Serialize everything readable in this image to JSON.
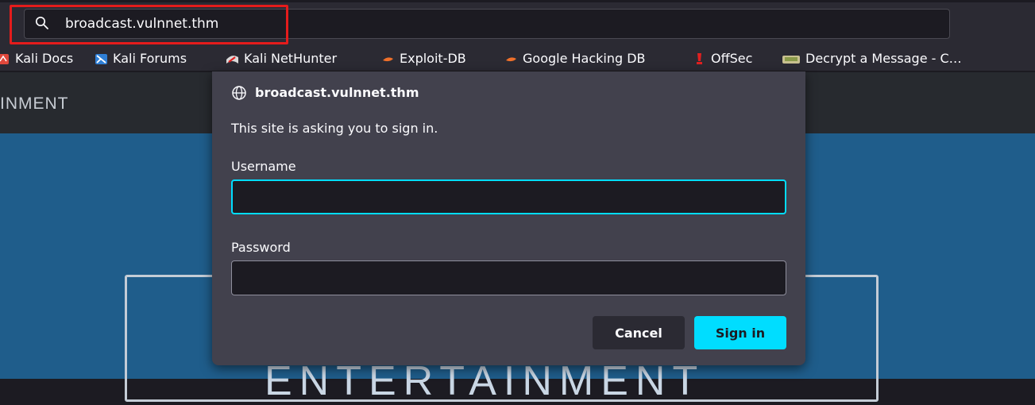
{
  "url_bar": {
    "text": "broadcast.vulnnet.thm"
  },
  "bookmarks": [
    {
      "label": "Kali Docs",
      "icon": "kali-dragon-icon"
    },
    {
      "label": "Kali Forums",
      "icon": "kali-forums-icon"
    },
    {
      "label": "Kali NetHunter",
      "icon": "nethunter-icon"
    },
    {
      "label": "Exploit-DB",
      "icon": "exploit-db-icon"
    },
    {
      "label": "Google Hacking DB",
      "icon": "ghdb-icon"
    },
    {
      "label": "OffSec",
      "icon": "offsec-icon"
    },
    {
      "label": "Decrypt a Message - C…",
      "icon": "decrypt-icon"
    }
  ],
  "page": {
    "brand_fragment": "INMENT",
    "hero_text_fragment": "ENTERTAINMENT"
  },
  "dialog": {
    "host": "broadcast.vulnnet.thm",
    "message": "This site is asking you to sign in.",
    "username_label": "Username",
    "username_value": "",
    "password_label": "Password",
    "password_value": "",
    "cancel_label": "Cancel",
    "signin_label": "Sign in"
  },
  "colors": {
    "accent": "#00ddff",
    "highlight_box": "#e41c1c",
    "dialog_bg": "#42414d",
    "hero_bg": "#1f5d8b"
  }
}
